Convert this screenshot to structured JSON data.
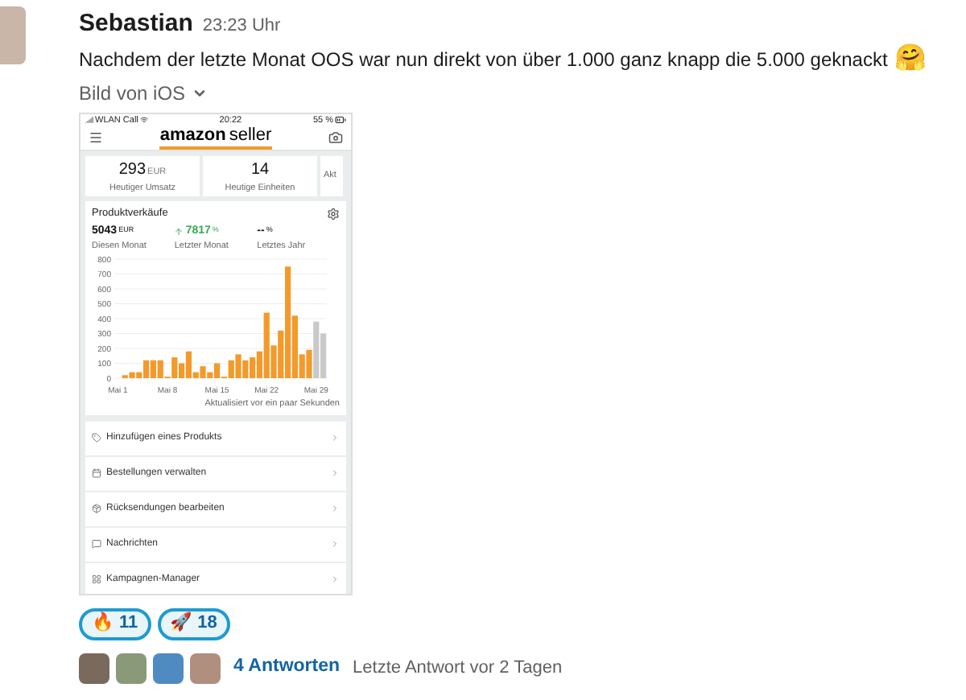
{
  "message": {
    "author": "Sebastian",
    "time": "23:23 Uhr",
    "text": "Nachdem der letzte Monat OOS war nun direkt von über 1.000 ganz knapp die 5.000 geknackt",
    "emoji": "🤗",
    "attachment_label": "Bild von iOS"
  },
  "phone": {
    "status_bar": {
      "carrier": "WLAN Call",
      "time": "20:22",
      "battery": "55 %"
    },
    "logo": {
      "brand": "amazon",
      "product": "seller"
    },
    "cards": [
      {
        "value": "293",
        "unit": "EUR",
        "label": "Heutiger Umsatz"
      },
      {
        "value": "14",
        "label": "Heutige Einheiten"
      },
      {
        "label": "Akt"
      }
    ],
    "sales": {
      "title": "Produktverkäufe",
      "stats": [
        {
          "value": "5043",
          "unit": "EUR",
          "label": "Diesen Monat",
          "rising": false
        },
        {
          "value": "7817",
          "unit": "%",
          "label": "Letzter Monat",
          "rising": true
        },
        {
          "value": "--",
          "unit": "%",
          "label": "Letztes Jahr",
          "rising": false
        }
      ],
      "chart_data": {
        "type": "bar",
        "stacked": true,
        "categories": [
          "Mai 1",
          null,
          null,
          null,
          null,
          null,
          null,
          "Mai 8",
          null,
          null,
          null,
          null,
          null,
          null,
          "Mai 15",
          null,
          null,
          null,
          null,
          null,
          null,
          "Mai 22",
          null,
          null,
          null,
          null,
          null,
          null,
          "Mai 29",
          null
        ],
        "series": [
          {
            "color": "#f39a2b",
            "values": [
              0,
              20,
              40,
              40,
              120,
              120,
              120,
              10,
              140,
              100,
              180,
              40,
              80,
              40,
              100,
              10,
              120,
              160,
              120,
              140,
              180,
              440,
              220,
              320,
              750,
              420,
              160,
              190,
              null,
              null
            ]
          },
          {
            "color": "#c9c9c9",
            "values": [
              null,
              null,
              null,
              null,
              null,
              null,
              null,
              null,
              null,
              null,
              null,
              null,
              null,
              null,
              null,
              null,
              null,
              null,
              null,
              null,
              null,
              null,
              null,
              null,
              null,
              null,
              null,
              null,
              380,
              300
            ]
          }
        ],
        "grid": true,
        "ylim": [
          0,
          800
        ],
        "yticks": [
          0,
          100,
          200,
          300,
          400,
          500,
          600,
          700,
          800
        ]
      },
      "updated": "Aktualisiert vor ein paar Sekunden"
    },
    "menu": [
      "Hinzufügen eines Produkts",
      "Bestellungen verwalten",
      "Rücksendungen bearbeiten",
      "Nachrichten",
      "Kampagnen-Manager"
    ]
  },
  "reactions": [
    {
      "emoji": "🔥",
      "count": "11",
      "selected": true
    },
    {
      "emoji": "🚀",
      "count": "18",
      "selected": true
    }
  ],
  "thread": {
    "replies": "4 Antworten",
    "last_reply": "Letzte Antwort vor 2 Tagen"
  }
}
